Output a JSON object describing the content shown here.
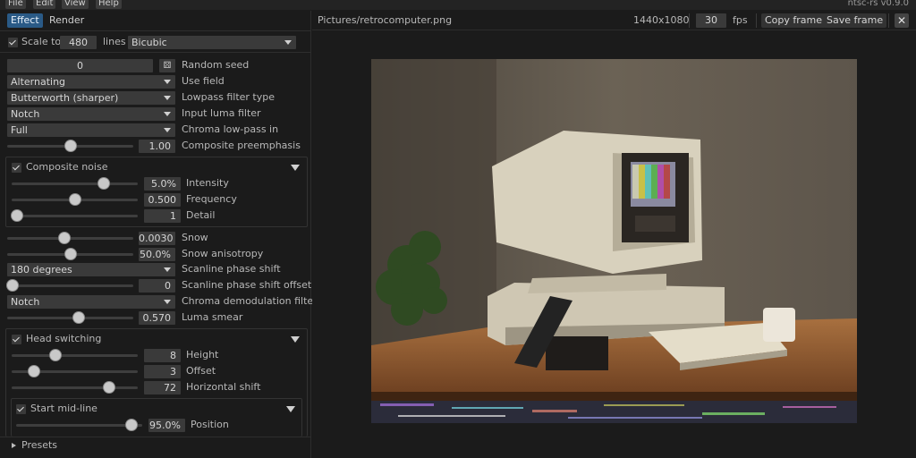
{
  "menubar": {
    "items": [
      "File",
      "Edit",
      "View",
      "Help"
    ],
    "version": "ntsc-rs v0.9.0"
  },
  "tabs": [
    "Effect",
    "Render"
  ],
  "scale": {
    "label": "Scale to",
    "value": "480",
    "unit": "lines",
    "filter": "Bicubic"
  },
  "controls": {
    "random_seed": {
      "value": "0",
      "label": "Random seed",
      "button_icon": "dice-icon"
    },
    "use_field": {
      "value": "Alternating",
      "label": "Use field"
    },
    "lowpass": {
      "value": "Butterworth (sharper)",
      "label": "Lowpass filter type"
    },
    "input_luma": {
      "value": "Notch",
      "label": "Input luma filter"
    },
    "chroma_lowpass_in": {
      "value": "Full",
      "label": "Chroma low-pass in"
    },
    "composite_preemphasis": {
      "value": "1.00",
      "label": "Composite preemphasis",
      "level": 0.5
    }
  },
  "composite_noise": {
    "title": "Composite noise",
    "checked": true,
    "intensity": {
      "value": "5.0%",
      "label": "Intensity",
      "level": 0.75
    },
    "frequency": {
      "value": "0.500",
      "label": "Frequency",
      "level": 0.5
    },
    "detail": {
      "value": "1",
      "label": "Detail",
      "level": 0.0
    }
  },
  "noise2": {
    "snow": {
      "value": "0.0030",
      "label": "Snow",
      "level": 0.45
    },
    "snow_anisotropy": {
      "value": "50.0%",
      "label": "Snow anisotropy",
      "level": 0.5
    },
    "scanline_phase_shift": {
      "value": "180 degrees",
      "label": "Scanline phase shift"
    },
    "scanline_phase_shift_offset": {
      "value": "0",
      "label": "Scanline phase shift offset",
      "level": 0.0
    },
    "chroma_demod": {
      "value": "Notch",
      "label": "Chroma demodulation filter"
    },
    "luma_smear": {
      "value": "0.570",
      "label": "Luma smear",
      "level": 0.57
    }
  },
  "head_switching": {
    "title": "Head switching",
    "checked": true,
    "height": {
      "value": "8",
      "label": "Height",
      "level": 0.33
    },
    "offset": {
      "value": "3",
      "label": "Offset",
      "level": 0.15
    },
    "horizontal_shift": {
      "value": "72",
      "label": "Horizontal shift",
      "level": 0.8
    },
    "mid_line": {
      "title": "Start mid-line",
      "checked": true,
      "position": {
        "value": "95.0%",
        "label": "Position",
        "level": 0.95
      }
    }
  },
  "presets": {
    "label": "Presets"
  },
  "toolbar": {
    "file_path": "Pictures/retrocomputer.png",
    "resolution": "1440x1080",
    "fps_value": "30",
    "fps_label": "fps",
    "copy_frame": "Copy frame",
    "save_frame": "Save frame"
  }
}
